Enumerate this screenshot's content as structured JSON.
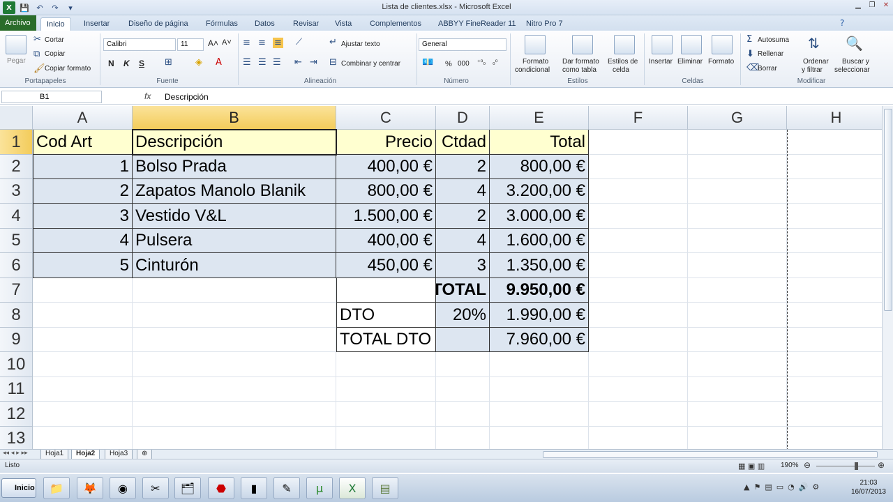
{
  "window": {
    "title": "Lista de clientes.xlsx - Microsoft Excel"
  },
  "tabs": [
    "Archivo",
    "Inicio",
    "Insertar",
    "Diseño de página",
    "Fórmulas",
    "Datos",
    "Revisar",
    "Vista",
    "Complementos",
    "ABBYY FineReader 11",
    "Nitro Pro 7"
  ],
  "ribbon": {
    "clipboard": {
      "paste": "Pegar",
      "cut": "Cortar",
      "copy": "Copiar",
      "format_painter": "Copiar formato",
      "group": "Portapapeles"
    },
    "font": {
      "name": "Calibri",
      "size": "11",
      "bold": "N",
      "italic": "K",
      "underline": "S",
      "group": "Fuente"
    },
    "alignment": {
      "wrap": "Ajustar texto",
      "merge": "Combinar y centrar",
      "group": "Alineación"
    },
    "number": {
      "format": "General",
      "percent": "%",
      "thousands": "000",
      "group": "Número"
    },
    "styles": {
      "conditional_1": "Formato",
      "conditional_2": "condicional",
      "as_table_1": "Dar formato",
      "as_table_2": "como tabla",
      "cell_styles_1": "Estilos de",
      "cell_styles_2": "celda",
      "group": "Estilos"
    },
    "cells": {
      "insert": "Insertar",
      "delete": "Eliminar",
      "format": "Formato",
      "group": "Celdas"
    },
    "editing": {
      "autosum": "Autosuma",
      "fill": "Rellenar",
      "clear": "Borrar",
      "sort_1": "Ordenar",
      "sort_2": "y filtrar",
      "find_1": "Buscar y",
      "find_2": "seleccionar",
      "group": "Modificar"
    }
  },
  "formula_bar": {
    "name_box": "B1",
    "fx": "fx",
    "content": "Descripción"
  },
  "columns": [
    "A",
    "B",
    "C",
    "D",
    "E",
    "F",
    "G",
    "H"
  ],
  "rows": [
    "1",
    "2",
    "3",
    "4",
    "5",
    "6",
    "7",
    "8",
    "9",
    "10",
    "11",
    "12",
    "13"
  ],
  "cells": {
    "A1": "Cod Art",
    "B1": "Descripción",
    "C1": "Precio",
    "D1": "Ctdad",
    "E1": "Total",
    "A2": "1",
    "B2": "Bolso Prada",
    "C2": "400,00 €",
    "D2": "2",
    "E2": "800,00 €",
    "A3": "2",
    "B3": "Zapatos Manolo Blanik",
    "C3": "800,00 €",
    "D3": "4",
    "E3": "3.200,00 €",
    "A4": "3",
    "B4": "Vestido V&L",
    "C4": "1.500,00 €",
    "D4": "2",
    "E4": "3.000,00 €",
    "A5": "4",
    "B5": "Pulsera",
    "C5": "400,00 €",
    "D5": "4",
    "E5": "1.600,00 €",
    "A6": "5",
    "B6": "Cinturón",
    "C6": "450,00 €",
    "D6": "3",
    "E6": "1.350,00 €",
    "D7": "TOTAL",
    "E7": "9.950,00 €",
    "C8": "DTO",
    "D8": "20%",
    "E8": "1.990,00 €",
    "C9": "TOTAL DTO",
    "E9": "7.960,00 €"
  },
  "sheets": [
    "Hoja1",
    "Hoja2",
    "Hoja3"
  ],
  "active_sheet": "Hoja2",
  "status": {
    "ready": "Listo",
    "zoom": "190%"
  },
  "taskbar": {
    "start": "Inicio",
    "time": "21:03",
    "date": "16/07/2013"
  },
  "colors": {
    "header_fill": "#ffffd0",
    "data_fill": "#dde6f1",
    "selected_header": "#f3cc5b",
    "archivo_tab": "#2a6c2a"
  }
}
